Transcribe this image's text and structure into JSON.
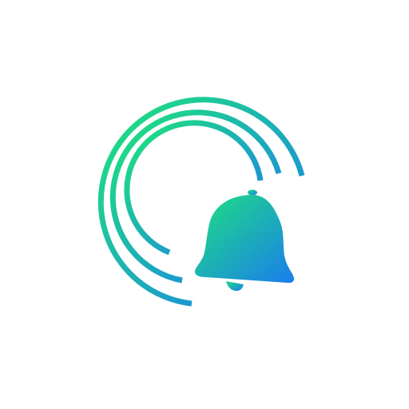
{
  "logo": {
    "icon": "bell-with-sound-waves-icon",
    "colors": {
      "gradient_start": "#1ed68a",
      "gradient_end": "#1a82e8",
      "background": "#ffffff"
    }
  }
}
